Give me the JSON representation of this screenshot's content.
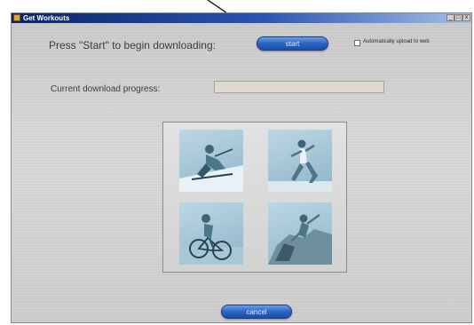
{
  "window": {
    "title": "Get Workouts",
    "controls": {
      "minimize": "_",
      "maximize": "□",
      "close": "x"
    }
  },
  "download": {
    "prompt": "Press \"Start\" to begin downloading:",
    "start_label": "start",
    "auto_upload_label": "Automatically upload to web",
    "auto_upload_checked": false,
    "progress_label": "Current download progress:",
    "progress_fraction": 0
  },
  "images": [
    {
      "name": "skier-photo"
    },
    {
      "name": "runner-photo"
    },
    {
      "name": "cyclist-photo"
    },
    {
      "name": "climber-photo"
    }
  ],
  "footer": {
    "cancel_label": "cancel"
  },
  "colors": {
    "accent": "#2c64c2",
    "titlebar": "#0a246a"
  },
  "icons": [
    "app-icon",
    "minimize-icon",
    "maximize-icon",
    "close-icon",
    "callout-arrow"
  ]
}
